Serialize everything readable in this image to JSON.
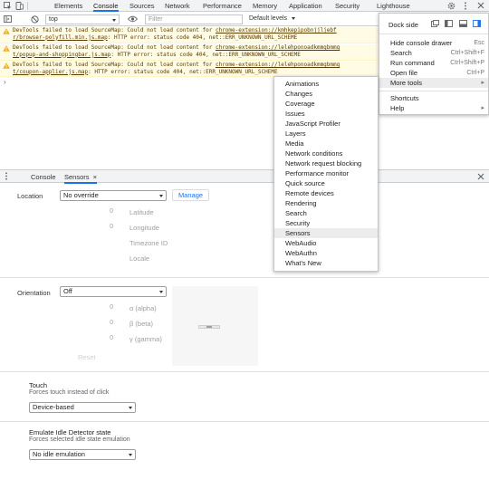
{
  "toolbar": {
    "tabs": [
      "Elements",
      "Console",
      "Sources",
      "Network",
      "Performance",
      "Memory",
      "Application",
      "Security",
      "Lighthouse"
    ],
    "active_tab": "Console"
  },
  "console_bar": {
    "context": "top",
    "filter_placeholder": "Filter",
    "levels": "Default levels"
  },
  "messages": [
    {
      "line1_prefix": "DevTools failed to load SourceMap: Could not load content for ",
      "line1_link": "chrome-extension://kmhkepipobnjjljebf",
      "line2_link": "r/browser-polyfill.min.js.map",
      "line2_rest": ": HTTP error: status code 404, net::ERR_UNKNOWN_URL_SCHEME"
    },
    {
      "line1_prefix": "DevTools failed to load SourceMap: Could not load content for ",
      "line1_link": "chrome-extension://lelehponoadkmmgbmmg",
      "line2_link": "t/popup-and-shoppingbar.js.map",
      "line2_rest": ": HTTP error: status code 404, net::ERR_UNKNOWN_URL_SCHEME"
    },
    {
      "line1_prefix": "DevTools failed to load SourceMap: Could not load content for ",
      "line1_link": "chrome-extension://lelehponoadkmmgbmmg",
      "line2_link": "t/coupon-applier.js.map",
      "line2_rest": ": HTTP error: status code 404, net::ERR_UNKNOWN_URL_SCHEME"
    }
  ],
  "prompt": "›",
  "drawer": {
    "tabs": [
      "Console",
      "Sensors"
    ],
    "active_tab": "Sensors",
    "close_glyph": "×"
  },
  "sensors": {
    "location_label": "Location",
    "location_value": "No override",
    "manage_label": "Manage",
    "coords": [
      {
        "value": "0",
        "label": "Latitude"
      },
      {
        "value": "0",
        "label": "Longitude"
      },
      {
        "value": "",
        "label": "Timezone ID"
      },
      {
        "value": "",
        "label": "Locale"
      }
    ],
    "orientation_label": "Orientation",
    "orientation_value": "Off",
    "angles": [
      {
        "value": "0",
        "label": "α (alpha)"
      },
      {
        "value": "0",
        "label": "β (beta)"
      },
      {
        "value": "0",
        "label": "γ (gamma)"
      }
    ],
    "reset_label": "Reset",
    "touch_title": "Touch",
    "touch_desc": "Forces touch instead of click",
    "touch_value": "Device-based",
    "idle_title": "Emulate Idle Detector state",
    "idle_desc": "Forces selected idle state emulation",
    "idle_value": "No idle emulation"
  },
  "main_menu": {
    "dock_side": "Dock side",
    "items": [
      {
        "label": "Hide console drawer",
        "shortcut": "Esc"
      },
      {
        "label": "Search",
        "shortcut": "Ctrl+Shift+F"
      },
      {
        "label": "Run command",
        "shortcut": "Ctrl+Shift+P"
      },
      {
        "label": "Open file",
        "shortcut": "Ctrl+P"
      },
      {
        "label": "More tools",
        "shortcut": "▸"
      },
      {
        "label": "Shortcuts",
        "shortcut": ""
      },
      {
        "label": "Help",
        "shortcut": "▸"
      }
    ]
  },
  "more_tools": {
    "items": [
      "Animations",
      "Changes",
      "Coverage",
      "Issues",
      "JavaScript Profiler",
      "Layers",
      "Media",
      "Network conditions",
      "Network request blocking",
      "Performance monitor",
      "Quick source",
      "Remote devices",
      "Rendering",
      "Search",
      "Security",
      "Sensors",
      "WebAudio",
      "WebAuthn",
      "What's New"
    ],
    "highlighted": "Sensors"
  },
  "colors": {
    "accent": "#1a73e8",
    "warning_bg": "#fffbe5",
    "warning_text": "#5c3c00",
    "toolbar_bg": "#f1f3f4"
  }
}
